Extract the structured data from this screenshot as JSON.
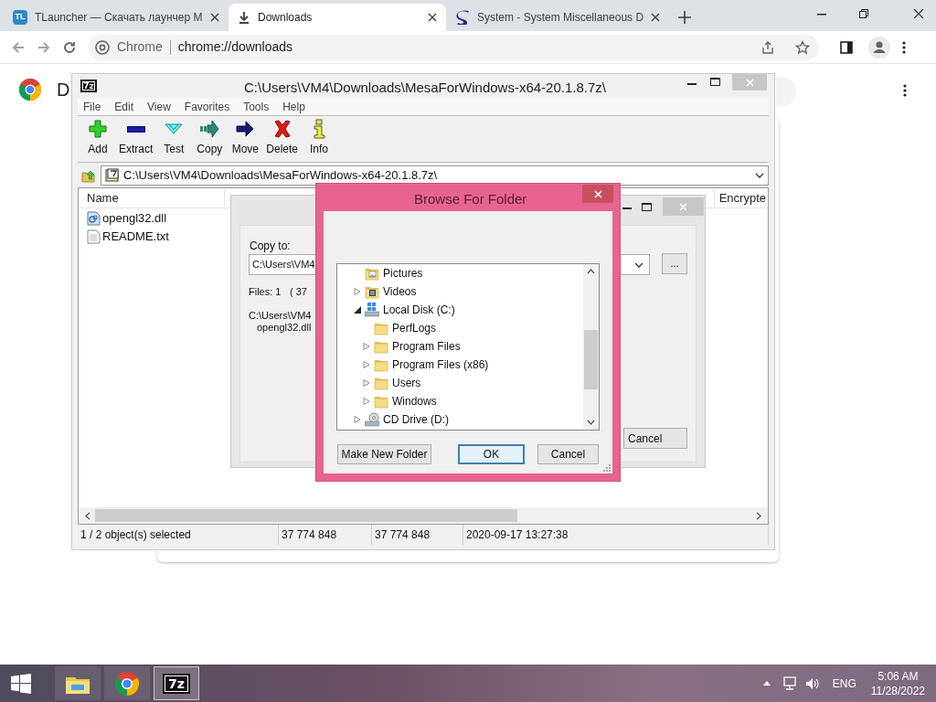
{
  "browser": {
    "tabs": [
      {
        "kind": "tlauncher",
        "badge": "TL",
        "title": "TLauncher — Скачать лаунчер М",
        "selected": false
      },
      {
        "kind": "downloads",
        "title": "Downloads",
        "selected": true
      },
      {
        "kind": "system",
        "title": "System - System Miscellaneous D",
        "selected": false
      }
    ],
    "omnibox": {
      "site_label": "Chrome",
      "url": "chrome://downloads"
    }
  },
  "page": {
    "heading": "D"
  },
  "archive_window": {
    "logo": "7z",
    "title": "C:\\Users\\VM4\\Downloads\\MesaForWindows-x64-20.1.8.7z\\",
    "menu": [
      "File",
      "Edit",
      "View",
      "Favorites",
      "Tools",
      "Help"
    ],
    "toolbar": [
      {
        "kind": "add",
        "label": "Add"
      },
      {
        "kind": "extract",
        "label": "Extract"
      },
      {
        "kind": "test",
        "label": "Test"
      },
      {
        "kind": "copy",
        "label": "Copy"
      },
      {
        "kind": "move",
        "label": "Move"
      },
      {
        "kind": "delete",
        "label": "Delete"
      },
      {
        "kind": "info",
        "label": "Info"
      }
    ],
    "path": "C:\\Users\\VM4\\Downloads\\MesaForWindows-x64-20.1.8.7z\\",
    "columns": [
      "Name",
      "Encrypte"
    ],
    "files": [
      {
        "kind": "dll",
        "name": "opengl32.dll"
      },
      {
        "kind": "text",
        "name": "README.txt"
      }
    ],
    "status_bar": [
      "1 / 2 object(s) selected",
      "37 774 848",
      "37 774 848",
      "2020-09-17 13:27:38"
    ]
  },
  "copy_dialog": {
    "label": "Copy to:",
    "destination": "C:\\Users\\VM4",
    "browse_button": "...",
    "files_count": "Files: 1",
    "size": "( 37",
    "source_path": "C:\\Users\\VM4",
    "source_file": "opengl32.dll",
    "cancel_button": "Cancel"
  },
  "browse_dialog": {
    "title": "Browse For Folder",
    "tree": [
      {
        "kind": "pictures",
        "label": "Pictures",
        "expandable": false,
        "expanded": false
      },
      {
        "kind": "videos",
        "label": "Videos",
        "expandable": true,
        "expanded": false
      },
      {
        "kind": "disk",
        "label": "Local Disk (C:)",
        "expandable": true,
        "expanded": true,
        "children": [
          {
            "kind": "folder",
            "label": "PerfLogs",
            "expandable": false,
            "expanded": false
          },
          {
            "kind": "folder",
            "label": "Program Files",
            "expandable": true,
            "expanded": false
          },
          {
            "kind": "folder",
            "label": "Program Files (x86)",
            "expandable": true,
            "expanded": false
          },
          {
            "kind": "folder",
            "label": "Users",
            "expandable": true,
            "expanded": false
          },
          {
            "kind": "folder",
            "label": "Windows",
            "expandable": true,
            "expanded": false
          }
        ]
      },
      {
        "kind": "cd",
        "label": "CD Drive (D:)",
        "expandable": true,
        "expanded": false
      }
    ],
    "buttons": [
      {
        "label": "Make New Folder",
        "focused": false
      },
      {
        "label": "OK",
        "focused": true
      },
      {
        "label": "Cancel",
        "focused": false
      }
    ]
  },
  "taskbar": {
    "apps": [
      {
        "kind": "explorer",
        "active": false
      },
      {
        "kind": "chrome",
        "active": false
      },
      {
        "kind": "archiver",
        "logo": "7z",
        "active": true
      }
    ],
    "language": "ENG",
    "time": "5:06 AM",
    "date": "11/28/2022"
  }
}
